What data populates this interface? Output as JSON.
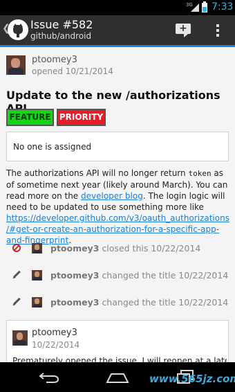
{
  "status_bar": {
    "network": "3G",
    "time": "7:33",
    "accent_color": "#33b5e5"
  },
  "action_bar": {
    "title": "Issue #582",
    "subtitle": "github/android",
    "icons": [
      "up-chevron-icon",
      "github-octocat-icon",
      "add-comment-icon",
      "overflow-menu-icon"
    ]
  },
  "issue": {
    "author": "ptoomey3",
    "opened": "opened 10/21/2014",
    "title": "Update to the new /authorizations API",
    "labels": [
      {
        "name": "FEATURE",
        "color": "#12d812"
      },
      {
        "name": "PRIORITY",
        "color": "#e81d2a"
      }
    ],
    "assignee": "No one is assigned",
    "body": {
      "p1": "The authorizations API will no longer return ",
      "code": "token",
      "p2": " as of sometime next year (likely around March). You can read more on the ",
      "link1": "developer blog",
      "p3": ". The login logic will need to be updated to use something more like ",
      "link2": "https://developer.github.com/v3/oauth_authorizations/#get-or-create-an-authorization-for-a-specific-app-and-fingerprint",
      "p4": "."
    }
  },
  "events": [
    {
      "icon": "closed-icon",
      "user": "ptoomey3",
      "action": "closed this 10/22/2014"
    },
    {
      "icon": "pencil-icon",
      "user": "ptoomey3",
      "action": "changed the title 10/22/2014"
    },
    {
      "icon": "pencil-icon",
      "user": "ptoomey3",
      "action": "changed the title 10/22/2014"
    }
  ],
  "comment": {
    "author": "ptoomey3",
    "date": "10/22/2014",
    "body": "Prematurely opened the issue. I will reopen at a later"
  },
  "nav_bar": {
    "icons": [
      "back-icon",
      "home-icon",
      "recents-icon"
    ],
    "watermark": "www.565jz.com"
  }
}
